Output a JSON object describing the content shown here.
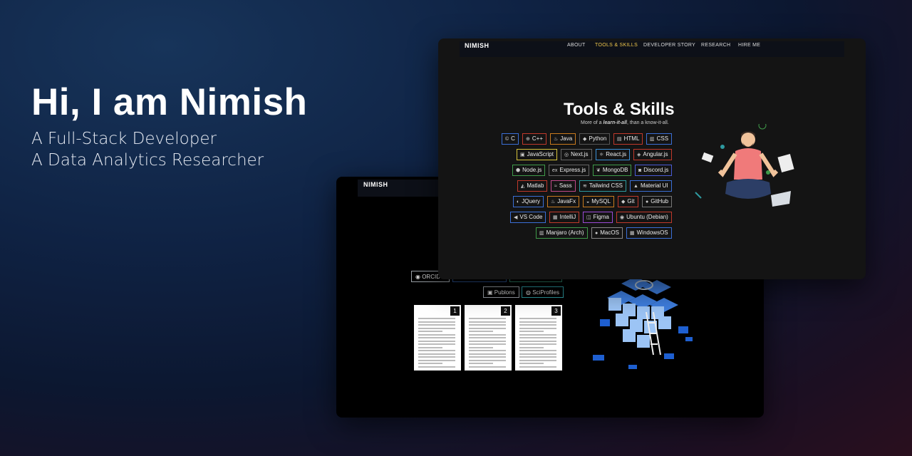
{
  "hero": {
    "title": "Hi, I am Nimish",
    "line1": "A Full-Stack Developer",
    "line2": "A Data Analytics Researcher"
  },
  "back_window": {
    "logo": "NIMISH",
    "links": [
      {
        "label": "ORCID",
        "icon": "orcid-icon",
        "color": "#9aa0a6"
      },
      {
        "label": "Publons",
        "icon": "publons-icon",
        "color": "#9aa0a6"
      },
      {
        "label": "SciProfiles",
        "icon": "sciprofiles-icon",
        "color": "#2e9aa0"
      }
    ],
    "papers": [
      "1",
      "2",
      "3"
    ]
  },
  "front_window": {
    "logo": "NIMISH",
    "nav": [
      "ABOUT",
      "TOOLS & SKILLS",
      "DEVELOPER STORY",
      "RESEARCH",
      "HIRE ME"
    ],
    "active_nav": "TOOLS & SKILLS",
    "title": "Tools & Skills",
    "subtitle_pre": "More of a ",
    "subtitle_em": "learn-it-all",
    "subtitle_post": ", than a know-it-all.",
    "skill_rows": [
      [
        {
          "label": "C",
          "icon": "c-icon",
          "color": "#3b6fd6"
        },
        {
          "label": "C++",
          "icon": "cpp-icon",
          "color": "#c0392b"
        },
        {
          "label": "Java",
          "icon": "java-icon",
          "color": "#c97a1e"
        },
        {
          "label": "Python",
          "icon": "python-icon",
          "color": "#555"
        },
        {
          "label": "HTML",
          "icon": "html-icon",
          "color": "#c0392b"
        },
        {
          "label": "CSS",
          "icon": "css-icon",
          "color": "#3b6fd6"
        }
      ],
      [
        {
          "label": "JavaScript",
          "icon": "javascript-icon",
          "color": "#d6c33b"
        },
        {
          "label": "Next.js",
          "icon": "nextjs-icon",
          "color": "#666"
        },
        {
          "label": "React.js",
          "icon": "react-icon",
          "color": "#3b8fd6"
        },
        {
          "label": "Angular.js",
          "icon": "angular-icon",
          "color": "#c0392b"
        }
      ],
      [
        {
          "label": "Node.js",
          "icon": "nodejs-icon",
          "color": "#3f9a4a"
        },
        {
          "label": "Express.js",
          "icon": "express-icon",
          "color": "#666"
        },
        {
          "label": "MongoDB",
          "icon": "mongodb-icon",
          "color": "#3f9a4a"
        },
        {
          "label": "Discord.js",
          "icon": "discord-icon",
          "color": "#4a5bd6"
        }
      ],
      [
        {
          "label": "Matlab",
          "icon": "matlab-icon",
          "color": "#c0392b"
        },
        {
          "label": "Sass",
          "icon": "sass-icon",
          "color": "#c04a8a"
        },
        {
          "label": "Tailwind CSS",
          "icon": "tailwind-icon",
          "color": "#2e9aa0"
        },
        {
          "label": "Material UI",
          "icon": "materialui-icon",
          "color": "#3b6fd6"
        }
      ],
      [
        {
          "label": "JQuery",
          "icon": "jquery-icon",
          "color": "#3b6fd6"
        },
        {
          "label": "JavaFx",
          "icon": "javafx-icon",
          "color": "#c97a1e"
        },
        {
          "label": "MySQL",
          "icon": "mysql-icon",
          "color": "#c97a1e"
        },
        {
          "label": "Git",
          "icon": "git-icon",
          "color": "#c0392b"
        },
        {
          "label": "GitHub",
          "icon": "github-icon",
          "color": "#777"
        }
      ],
      [
        {
          "label": "VS Code",
          "icon": "vscode-icon",
          "color": "#3b6fd6"
        },
        {
          "label": "IntelliJ",
          "icon": "intellij-icon",
          "color": "#c0392b"
        },
        {
          "label": "Figma",
          "icon": "figma-icon",
          "color": "#9b4ad6"
        },
        {
          "label": "Ubuntu (Debian)",
          "icon": "ubuntu-icon",
          "color": "#c0392b"
        }
      ],
      [
        {
          "label": "Manjaro (Arch)",
          "icon": "manjaro-icon",
          "color": "#3f9a4a"
        },
        {
          "label": "MacOS",
          "icon": "apple-icon",
          "color": "#888"
        },
        {
          "label": "WindowsOS",
          "icon": "windows-icon",
          "color": "#3b6fd6"
        }
      ]
    ]
  }
}
